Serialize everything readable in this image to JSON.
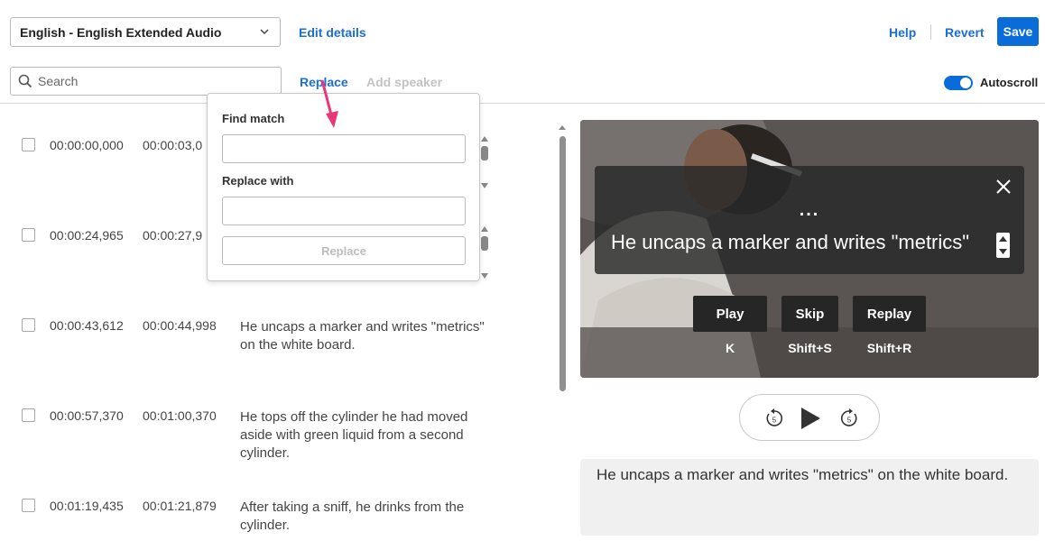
{
  "header": {
    "language_select": "English - English Extended Audio",
    "edit_details": "Edit details",
    "help": "Help",
    "revert": "Revert",
    "save": "Save"
  },
  "toolbar": {
    "search_placeholder": "Search",
    "replace": "Replace",
    "add_speaker": "Add speaker",
    "autoscroll_label": "Autoscroll",
    "autoscroll_on": true
  },
  "replace_popup": {
    "find_label": "Find match",
    "replace_label": "Replace with",
    "replace_button": "Replace"
  },
  "transcript": [
    {
      "start": "00:00:00,000",
      "end": "00:00:03,0",
      "text": ""
    },
    {
      "start": "00:00:24,965",
      "end": "00:00:27,9",
      "text": ""
    },
    {
      "start": "00:00:43,612",
      "end": "00:00:44,998",
      "text": "He uncaps a marker and writes \"metrics\" on the white board."
    },
    {
      "start": "00:00:57,370",
      "end": "00:01:00,370",
      "text": "He tops off the cylinder he had moved aside with green liquid from a second cylinder."
    },
    {
      "start": "00:01:19,435",
      "end": "00:01:21,879",
      "text": "After taking a sniff, he drinks from the cylinder."
    }
  ],
  "video": {
    "overlay_dots": "...",
    "overlay_caption": "He uncaps a marker and writes \"metrics\"",
    "buttons": [
      {
        "label": "Play",
        "key": "K"
      },
      {
        "label": "Skip",
        "key": "Shift+S"
      },
      {
        "label": "Replay",
        "key": "Shift+R"
      }
    ]
  },
  "player": {
    "rewind_seconds": "5",
    "forward_seconds": "5"
  },
  "description": "He uncaps a marker and writes \"metrics\" on the white board.",
  "colors": {
    "accent": "#0a6cd8",
    "arrow": "#e6397a"
  }
}
